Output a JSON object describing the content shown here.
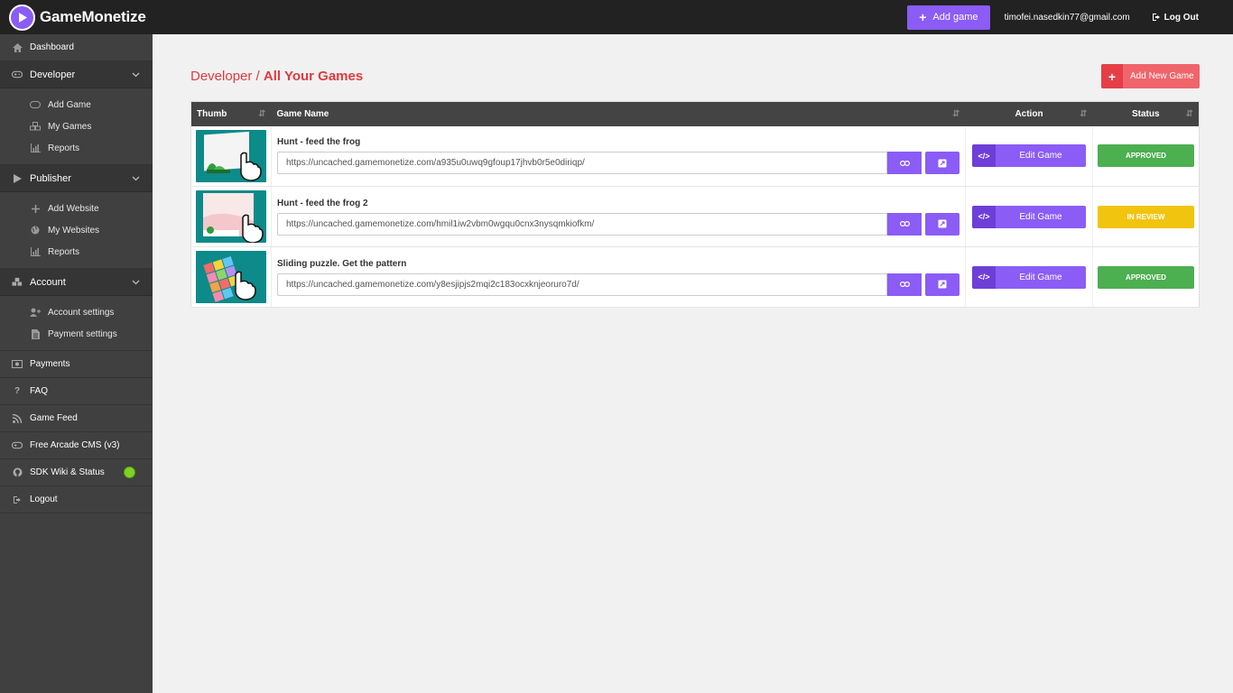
{
  "app": {
    "logo_text": "GameMonetize"
  },
  "topbar": {
    "add_game_label": "Add game",
    "user_email": "timofei.nasedkin77@gmail.com",
    "logout_label": "Log Out"
  },
  "sidebar": {
    "dashboard": "Dashboard",
    "developer": {
      "label": "Developer",
      "items": [
        "Add Game",
        "My Games",
        "Reports"
      ]
    },
    "publisher": {
      "label": "Publisher",
      "items": [
        "Add Website",
        "My Websites",
        "Reports"
      ]
    },
    "account": {
      "label": "Account",
      "items": [
        "Account settings",
        "Payment settings"
      ]
    },
    "links": [
      "Payments",
      "FAQ",
      "Game Feed",
      "Free Arcade CMS (v3)",
      "SDK Wiki & Status",
      "Logout"
    ]
  },
  "main": {
    "breadcrumb_parent": "Developer",
    "breadcrumb_sep": "/",
    "breadcrumb_current": "All Your Games",
    "add_new_label": "Add New Game",
    "columns": {
      "thumb": "Thumb",
      "name": "Game Name",
      "action": "Action",
      "status": "Status"
    },
    "games": [
      {
        "name": "Hunt - feed the frog",
        "url": "https://uncached.gamemonetize.com/a935u0uwq9gfoup17jhvb0r5e0diriqp/",
        "action_label": "Edit Game",
        "status": "APPROVED",
        "status_color": "#4caf50"
      },
      {
        "name": "Hunt - feed the frog 2",
        "url": "https://uncached.gamemonetize.com/hmil1iw2vbm0wgqu0cnx3nysqmkiofkm/",
        "action_label": "Edit Game",
        "status": "IN REVIEW",
        "status_color": "#f1c40f"
      },
      {
        "name": "Sliding puzzle. Get the pattern",
        "url": "https://uncached.gamemonetize.com/y8esjipjs2mqi2c183ocxknjeoruro7d/",
        "action_label": "Edit Game",
        "status": "APPROVED",
        "status_color": "#4caf50"
      }
    ]
  },
  "colors": {
    "accent": "#8b5cf6",
    "danger": "#e03a3e",
    "topbar": "#222222",
    "sidebar": "#404040"
  }
}
